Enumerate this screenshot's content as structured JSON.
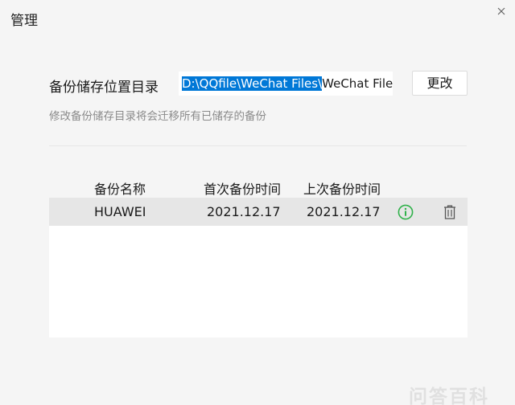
{
  "window": {
    "title": "管理"
  },
  "backup_dir": {
    "label": "备份储存位置目录",
    "path_selected": "D:\\QQfile\\WeChat Files\\",
    "path_rest": "WeChat Files\\v",
    "change_label": "更改",
    "hint": "修改备份储存目录将会迁移所有已储存的备份"
  },
  "table": {
    "columns": [
      "备份名称",
      "首次备份时间",
      "上次备份时间"
    ],
    "rows": [
      {
        "name": "HUAWEI",
        "first": "2021.12.17",
        "last": "2021.12.17"
      }
    ]
  },
  "icons": {
    "close": "close-icon",
    "info": "info-icon",
    "delete": "trash-icon"
  },
  "colors": {
    "selection": "#0078d7",
    "info": "#2fb14a",
    "row_bg": "#e6e6e6"
  },
  "watermark": "问答百科"
}
